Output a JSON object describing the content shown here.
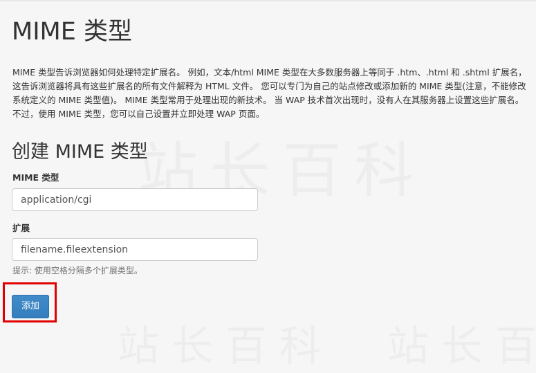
{
  "page": {
    "title": "MIME 类型",
    "description": "MIME 类型告诉浏览器如何处理特定扩展名。 例如，文本/html MIME 类型在大多数服务器上等同于 .htm、.html 和 .shtml 扩展名，这告诉浏览器将具有这些扩展名的所有文件解释为 HTML 文件。 您可以专门为自己的站点修改或添加新的 MIME 类型(注意，不能修改系统定义的 MIME 类型值)。 MIME 类型常用于处理出现的新技术。 当 WAP 技术首次出现时，没有人在其服务器上设置这些扩展名。 不过，使用 MIME 类型，您可以自己设置并立即处理 WAP 页面。"
  },
  "create_form": {
    "title": "创建 MIME 类型",
    "mime_type": {
      "label": "MIME 类型",
      "value": "",
      "placeholder": "application/cgi"
    },
    "extensions": {
      "label": "扩展",
      "value": "",
      "placeholder": "filename.fileextension",
      "help": "提示: 使用空格分隔多个扩展类型。"
    },
    "add_button_label": "添加"
  },
  "watermark": {
    "text": "站长百科"
  },
  "colors": {
    "background": "#f6f6f6",
    "primary_button": "#428bca",
    "highlight": "#e00000"
  }
}
